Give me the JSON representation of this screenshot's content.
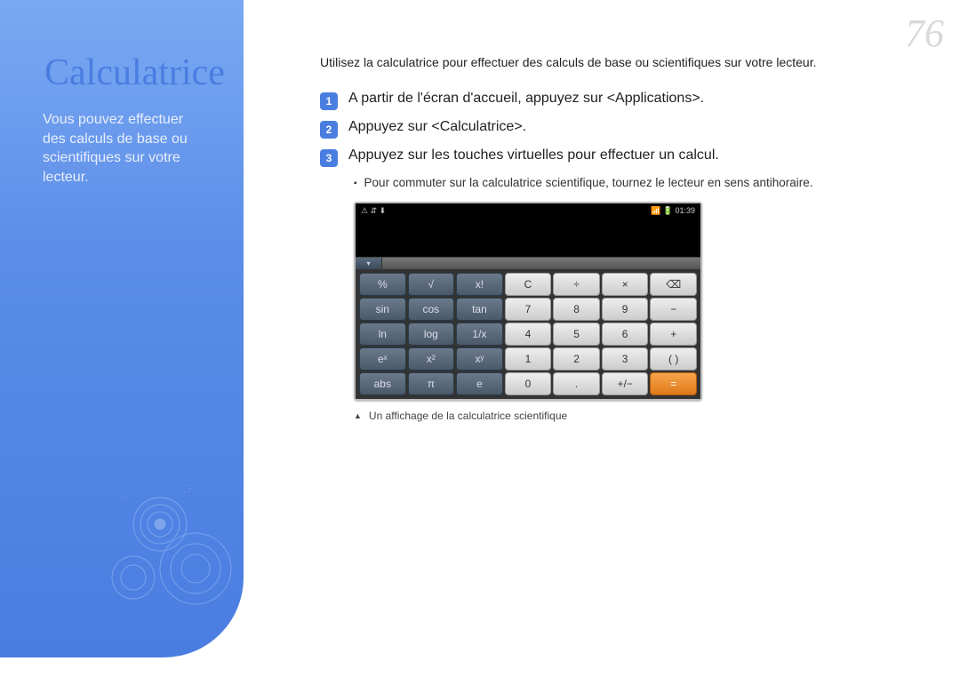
{
  "page_number": "76",
  "sidebar": {
    "title": "Calculatrice",
    "subtitle": "Vous pouvez effectuer des calculs de base ou scientifiques sur votre lecteur."
  },
  "intro": "Utilisez la calculatrice pour effectuer des calculs de base ou scientifiques sur votre lecteur.",
  "steps": [
    {
      "num": "1",
      "text": "A partir de l'écran d'accueil, appuyez sur <Applications>."
    },
    {
      "num": "2",
      "text": "Appuyez sur <Calculatrice>."
    },
    {
      "num": "3",
      "text": "Appuyez sur les touches virtuelles pour effectuer un calcul."
    }
  ],
  "sub_bullet": "Pour commuter sur la calculatrice scientifique, tournez le lecteur en sens antihoraire.",
  "caption": "Un affichage de la calculatrice scientifique",
  "calc": {
    "status_left": "⚠ ⇵ ⬇",
    "status_right": "📶 🔋 01:39",
    "tab_arrow": "▾",
    "keys": [
      {
        "t": "%",
        "c": "dark"
      },
      {
        "t": "√",
        "c": "dark"
      },
      {
        "t": "x!",
        "c": "dark"
      },
      {
        "t": "C",
        "c": "lite"
      },
      {
        "t": "÷",
        "c": "lite"
      },
      {
        "t": "×",
        "c": "lite"
      },
      {
        "t": "⌫",
        "c": "lite"
      },
      {
        "t": "",
        "c": "gone"
      },
      {
        "t": "sin",
        "c": "dark"
      },
      {
        "t": "cos",
        "c": "dark"
      },
      {
        "t": "tan",
        "c": "dark"
      },
      {
        "t": "7",
        "c": "lite"
      },
      {
        "t": "8",
        "c": "lite"
      },
      {
        "t": "9",
        "c": "lite"
      },
      {
        "t": "−",
        "c": "lite"
      },
      {
        "t": "",
        "c": "gone"
      },
      {
        "t": "ln",
        "c": "dark"
      },
      {
        "t": "log",
        "c": "dark"
      },
      {
        "t": "1/x",
        "c": "dark"
      },
      {
        "t": "4",
        "c": "lite"
      },
      {
        "t": "5",
        "c": "lite"
      },
      {
        "t": "6",
        "c": "lite"
      },
      {
        "t": "+",
        "c": "lite"
      },
      {
        "t": "",
        "c": "gone"
      },
      {
        "t": "eˣ",
        "c": "dark"
      },
      {
        "t": "x²",
        "c": "dark"
      },
      {
        "t": "xʸ",
        "c": "dark"
      },
      {
        "t": "1",
        "c": "lite"
      },
      {
        "t": "2",
        "c": "lite"
      },
      {
        "t": "3",
        "c": "lite"
      },
      {
        "t": "( )",
        "c": "lite"
      },
      {
        "t": "",
        "c": "gone"
      },
      {
        "t": "abs",
        "c": "dark"
      },
      {
        "t": "π",
        "c": "dark"
      },
      {
        "t": "e",
        "c": "dark"
      },
      {
        "t": "0",
        "c": "lite"
      },
      {
        "t": ".",
        "c": "lite"
      },
      {
        "t": "+/−",
        "c": "lite"
      },
      {
        "t": "=",
        "c": "orange"
      },
      {
        "t": "",
        "c": "gone"
      }
    ]
  }
}
